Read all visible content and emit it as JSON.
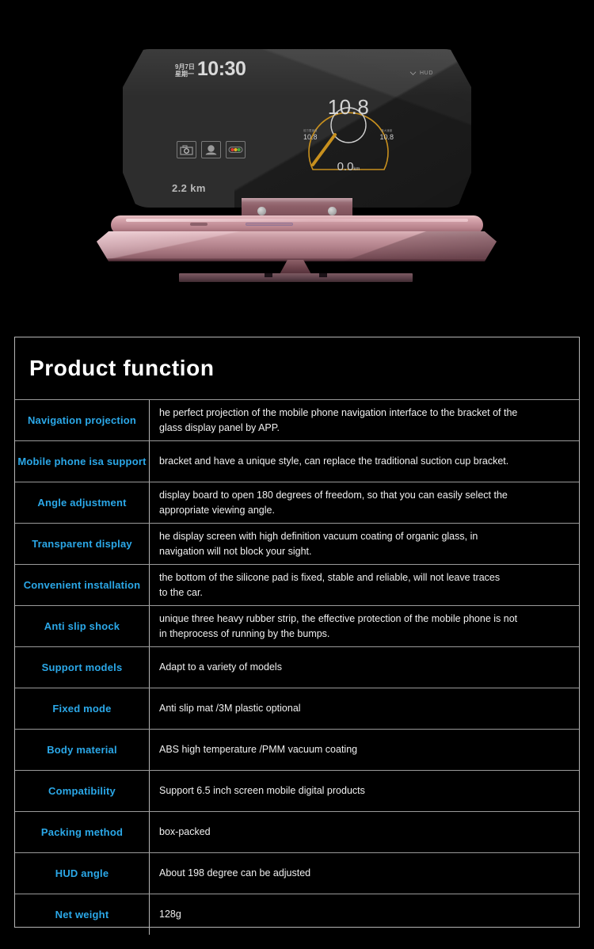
{
  "product_image": {
    "hud_display": {
      "date_line1": "9月7日",
      "date_line2": "星期一",
      "time": "10:30",
      "hud_toggle_label": "HUD",
      "distance": "2.2 km",
      "gauge": {
        "speed": "10.8",
        "left_small_label": "前方限速值",
        "left_value": "10.8",
        "right_small_label": "最大速度",
        "right_value": "10.8",
        "bottom_value": "0.0",
        "bottom_unit": "km"
      },
      "icons": [
        "camera-icon",
        "speed-camera-icon",
        "traffic-light-icon"
      ]
    },
    "colors": {
      "device_rose_gold": "#c89aa2",
      "gauge_arc": "#c8901e",
      "glass_panel": "#2b2b2b"
    }
  },
  "spec_table": {
    "title": "Product function",
    "accent_color": "#2ba8e8",
    "rows": [
      {
        "label": "Navigation projection",
        "desc_lines": [
          "he perfect projection of the mobile phone navigation interface to the bracket of the",
          " glass display panel by APP."
        ]
      },
      {
        "label_lines": [
          "Mobile phone is",
          "a support"
        ],
        "label": "Mobile phone is a support",
        "desc_lines": [
          "bracket and have a unique style, can replace the traditional suction cup bracket."
        ]
      },
      {
        "label": "Angle adjustment",
        "desc_lines": [
          "display board to open 180 degrees of freedom, so that you can easily select the",
          "appropriate viewing angle."
        ]
      },
      {
        "label": "Transparent display",
        "desc_lines": [
          "he display screen with high definition vacuum coating of organic glass, in",
          "navigation will not block your sight."
        ]
      },
      {
        "label": "Convenient installation",
        "desc_lines": [
          " the bottom of the silicone pad is fixed, stable and reliable, will not leave traces",
          " to the car."
        ]
      },
      {
        "label": "Anti slip shock",
        "desc_lines": [
          "unique three heavy rubber strip, the effective protection of the mobile phone is not",
          "in theprocess of running by the bumps."
        ]
      },
      {
        "label": "Support models",
        "desc_lines": [
          " Adapt to a variety of models"
        ]
      },
      {
        "label": "Fixed mode",
        "desc_lines": [
          "Anti slip mat /3M plastic optional"
        ]
      },
      {
        "label": "Body material",
        "desc_lines": [
          "ABS high temperature /PMM vacuum coating"
        ]
      },
      {
        "label": "Compatibility",
        "desc_lines": [
          "Support 6.5 inch screen mobile digital products"
        ]
      },
      {
        "label": "Packing method",
        "desc_lines": [
          "box-packed"
        ]
      },
      {
        "label": "HUD angle",
        "desc_lines": [
          "About 198 degree can be adjusted"
        ]
      },
      {
        "label": "Net weight",
        "desc_lines": [
          "128g"
        ]
      }
    ]
  }
}
